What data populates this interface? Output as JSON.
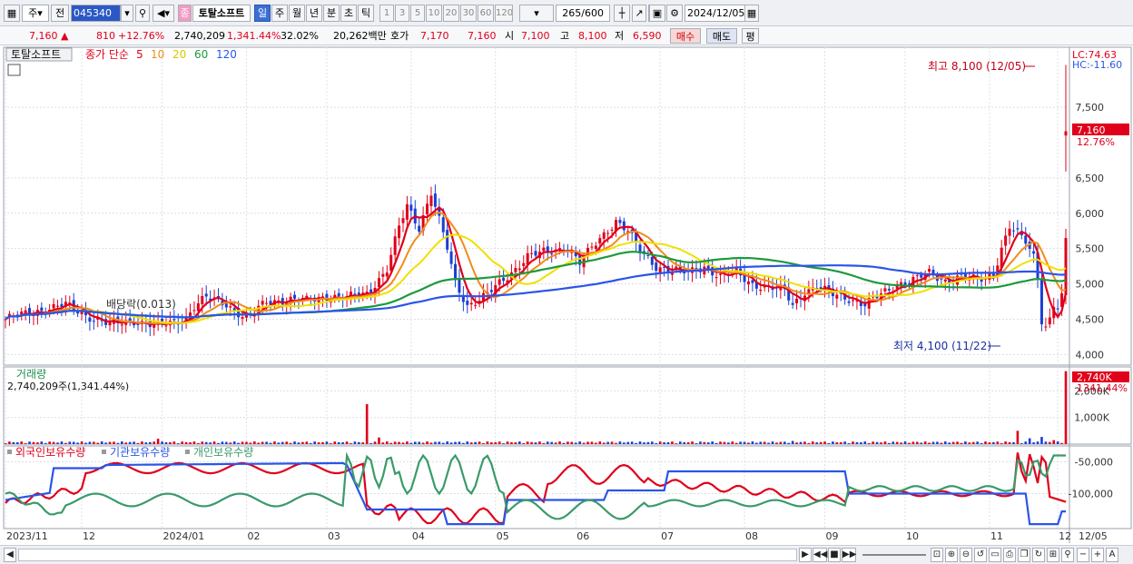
{
  "toolbar": {
    "type_label": "주",
    "prev_label": "전",
    "code": "045340",
    "stock_badge": "종",
    "stock_name": "토탈소프트",
    "periods": [
      "일",
      "주",
      "월",
      "년",
      "분",
      "초",
      "틱"
    ],
    "active_period": "일",
    "intervals": [
      "1",
      "3",
      "5",
      "10",
      "20",
      "30",
      "60",
      "120"
    ],
    "count_current": "265",
    "count_total": "/600",
    "date": "2024/12/05"
  },
  "quote": {
    "price": "7,160",
    "change": "810",
    "change_pct": "+12.76%",
    "volume": "2,740,209",
    "volume_pct": "1,341.44%",
    "turnover_pct": "32.02%",
    "amount": "20,262백만",
    "bid_label": "호가",
    "ask_price": "7,170",
    "bid_price": "7,160",
    "open_label": "시",
    "open": "7,100",
    "high_label": "고",
    "high": "8,100",
    "low_label": "저",
    "low": "6,590",
    "buy_label": "매수",
    "sell_label": "매도",
    "eval_label": "평"
  },
  "colors": {
    "ma5": "#e0001b",
    "ma10": "#f08c1c",
    "ma20": "#f0e000",
    "ma60": "#1c9a3c",
    "ma120": "#2a55e8",
    "up": "#e0001b",
    "down": "#1a3fd4",
    "foreign": "#e0001b",
    "institution": "#2a55e8",
    "individual": "#3a9a6a"
  },
  "chart_data": [
    {
      "type": "candlestick",
      "title": "토탈소프트",
      "legend_prefix": "종가 단순",
      "legend": [
        "5",
        "10",
        "20",
        "60",
        "120"
      ],
      "x_ticks": [
        "2023/11",
        "12",
        "2024/01",
        "02",
        "03",
        "04",
        "05",
        "06",
        "07",
        "08",
        "09",
        "10",
        "11",
        "12"
      ],
      "x_end_label": "12/05",
      "y_ticks": [
        "4,000",
        "4,500",
        "5,000",
        "5,500",
        "6,000",
        "6,500",
        "7,500"
      ],
      "ylim": [
        3850,
        8350
      ],
      "lc_label": "LC:74.63",
      "hc_label": "HC:-11.60",
      "last_price_label": "7,160",
      "last_change_label": "12.76%",
      "high_annotation": "최고 8,100 (12/05)",
      "low_annotation": "최저 4,100 (11/22)",
      "dividend_annotation": "배당락(0.013)",
      "close_path": [
        [
          0,
          4500
        ],
        [
          8,
          4620
        ],
        [
          15,
          4700
        ],
        [
          20,
          4560
        ],
        [
          26,
          4420
        ],
        [
          32,
          4480
        ],
        [
          38,
          4400
        ],
        [
          42,
          4460
        ],
        [
          45,
          4520
        ],
        [
          47,
          4680
        ],
        [
          50,
          4800
        ],
        [
          55,
          4720
        ],
        [
          60,
          4500
        ],
        [
          65,
          4750
        ],
        [
          70,
          4780
        ],
        [
          75,
          4760
        ],
        [
          80,
          4830
        ],
        [
          85,
          4800
        ],
        [
          90,
          4870
        ],
        [
          95,
          5200
        ],
        [
          98,
          5800
        ],
        [
          100,
          6100
        ],
        [
          103,
          5800
        ],
        [
          106,
          6300
        ],
        [
          110,
          5500
        ],
        [
          112,
          5000
        ],
        [
          115,
          4700
        ],
        [
          120,
          4850
        ],
        [
          125,
          5100
        ],
        [
          130,
          5400
        ],
        [
          135,
          5450
        ],
        [
          140,
          5520
        ],
        [
          143,
          5300
        ],
        [
          146,
          5500
        ],
        [
          149,
          5700
        ],
        [
          152,
          5900
        ],
        [
          155,
          5750
        ],
        [
          158,
          5450
        ],
        [
          162,
          5250
        ],
        [
          166,
          5200
        ],
        [
          170,
          5150
        ],
        [
          174,
          5250
        ],
        [
          178,
          5100
        ],
        [
          182,
          5150
        ],
        [
          186,
          5000
        ],
        [
          190,
          4950
        ],
        [
          194,
          4900
        ],
        [
          196,
          4700
        ],
        [
          199,
          4900
        ],
        [
          202,
          4950
        ],
        [
          206,
          4850
        ],
        [
          210,
          4800
        ],
        [
          214,
          4700
        ],
        [
          218,
          4850
        ],
        [
          222,
          5000
        ],
        [
          226,
          5050
        ],
        [
          230,
          5150
        ],
        [
          234,
          5050
        ],
        [
          238,
          5100
        ],
        [
          242,
          5050
        ],
        [
          246,
          5150
        ],
        [
          248,
          5500
        ],
        [
          250,
          5800
        ],
        [
          252,
          5700
        ],
        [
          254,
          5600
        ],
        [
          256,
          5400
        ],
        [
          257,
          5100
        ],
        [
          258,
          4500
        ],
        [
          259,
          4400
        ],
        [
          260,
          4500
        ],
        [
          261,
          4700
        ],
        [
          262,
          4650
        ],
        [
          263,
          4800
        ],
        [
          264,
          5600
        ]
      ],
      "volume_label": "거래량",
      "volume_value": "2,740,209주(1,341.44%)",
      "volume_ticks": [
        "1,000K",
        "2,000K"
      ],
      "volume_last_label": "2,740K",
      "volume_last_pct": "1341.44%",
      "volume_ylim": [
        0,
        2900000
      ],
      "volume_spikes": [
        [
          38,
          200000
        ],
        [
          90,
          1500000
        ],
        [
          93,
          250000
        ],
        [
          196,
          120000
        ],
        [
          252,
          500000
        ],
        [
          255,
          220000
        ],
        [
          258,
          270000
        ],
        [
          261,
          150000
        ],
        [
          264,
          2740209
        ]
      ],
      "holdings_legend": [
        "외국인보유수량",
        "기관보유수량",
        "개인보유수량"
      ],
      "holdings_ticks": [
        "-50,000",
        "-100,000"
      ],
      "holdings_ylim": [
        -155000,
        -25000
      ]
    }
  ],
  "status": {
    "buttons": [
      "▶",
      "◀◀",
      "■",
      "▶▶"
    ],
    "zoom": [
      "−",
      "+",
      "A"
    ]
  }
}
